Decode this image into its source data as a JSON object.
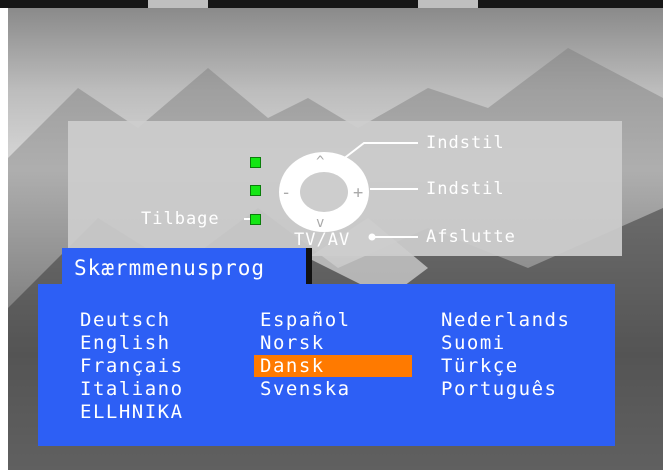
{
  "help": {
    "ok_label": "Indstil",
    "plus_label": "Indstil",
    "exit_label": "Afslutte",
    "back_label": "Tilbage",
    "tvav_label": "TV/AV",
    "up_glyph": "^",
    "down_glyph": "v",
    "minus_glyph": "-",
    "plus_glyph": "+"
  },
  "menu": {
    "title": "Skærmmenusprog",
    "selected": "Dansk",
    "columns": [
      [
        "Deutsch",
        "English",
        "Français",
        "Italiano",
        "ELLHNIKA"
      ],
      [
        "Español",
        "Norsk",
        "Dansk",
        "Svenska"
      ],
      [
        "Nederlands",
        "Suomi",
        "Türkçe",
        "Português"
      ]
    ]
  },
  "colors": {
    "panel_blue": "#2d5ff5",
    "highlight": "#ff7a00",
    "led_green": "#14e614"
  }
}
